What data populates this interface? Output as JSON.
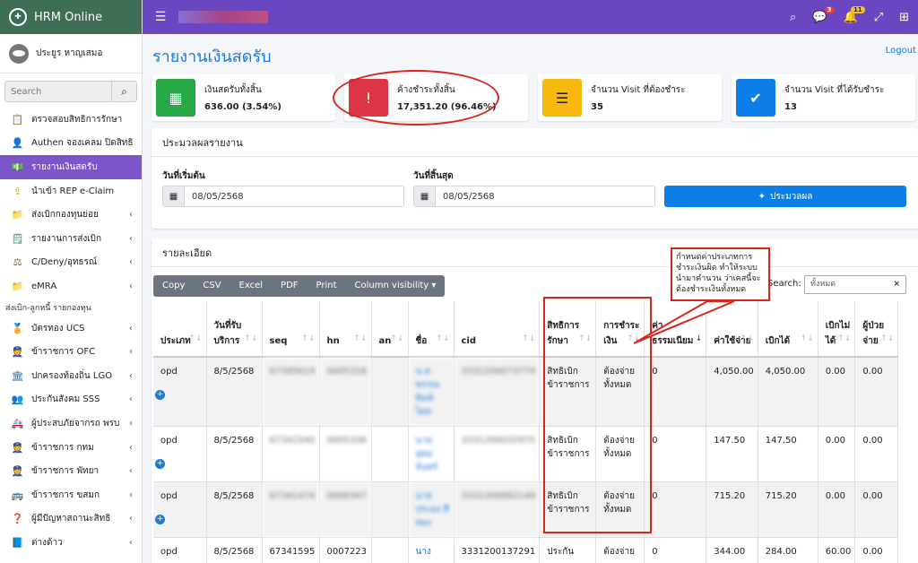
{
  "app": {
    "title": "HRM Online"
  },
  "user": {
    "name": "ประยูร หาญเสมอ"
  },
  "sidebar": {
    "search_placeholder": "Search",
    "items": [
      {
        "label": "ตรวจสอบสิทธิการรักษา",
        "icon": "clipboard-icon",
        "active": false,
        "chevron": false
      },
      {
        "label": "Authen จองเคลม ปิดสิทธิ",
        "icon": "doctor-icon",
        "active": false,
        "chevron": false
      },
      {
        "label": "รายงานเงินสดรับ",
        "icon": "money-icon",
        "active": true,
        "chevron": false
      },
      {
        "label": "นำเข้า REP e-Claim",
        "icon": "import-icon",
        "active": false,
        "chevron": false
      },
      {
        "label": "ส่งเบิกกองทุนย่อย",
        "icon": "folder-icon",
        "active": false,
        "chevron": true
      },
      {
        "label": "รายงานการส่งเบิก",
        "icon": "report-icon",
        "active": false,
        "chevron": true
      },
      {
        "label": "C/Deny/อุทธรณ์",
        "icon": "gavel-icon",
        "active": false,
        "chevron": true
      },
      {
        "label": "eMRA",
        "icon": "folder-icon",
        "active": false,
        "chevron": true
      }
    ],
    "section_header": "ส่งเบิก-ลูกหนี้ รายกองทุน",
    "items2": [
      {
        "label": "บัตรทอง UCS",
        "icon": "gold-card-icon"
      },
      {
        "label": "ข้าราชการ OFC",
        "icon": "officer-icon"
      },
      {
        "label": "ปกครองท้องถิ่น LGO",
        "icon": "building-icon"
      },
      {
        "label": "ประกันสังคม SSS",
        "icon": "people-icon"
      },
      {
        "label": "ผู้ประสบภัยจากรถ พรบ",
        "icon": "car-icon"
      },
      {
        "label": "ข้าราชการ กทม",
        "icon": "officer-icon"
      },
      {
        "label": "ข้าราชการ พัทยา",
        "icon": "officer-icon"
      },
      {
        "label": "ข้าราชการ ขสมก",
        "icon": "bus-icon"
      },
      {
        "label": "ผู้มีปัญหาสถานะสิทธิ",
        "icon": "question-icon"
      },
      {
        "label": "ต่างด้าว",
        "icon": "passport-icon"
      }
    ]
  },
  "topbar": {
    "badge_chat": "3",
    "badge_bell": "11"
  },
  "page": {
    "title": "รายงานเงินสดรับ",
    "logout": "Logout"
  },
  "cards": [
    {
      "label": "เงินสดรับทั้งสิ้น",
      "value": "636.00 (3.54%)",
      "color": "#28a745",
      "icon": "cash-register-icon"
    },
    {
      "label": "ค้างชำระทั้งสิ้น",
      "value": "17,351.20 (96.46%)",
      "color": "#dc3545",
      "icon": "alert-icon"
    },
    {
      "label": "จำนวน Visit ที่ต้องชำระ",
      "value": "35",
      "color": "#f7b90e",
      "icon": "list-check-icon"
    },
    {
      "label": "จำนวน Visit ที่ได้รับชำระ",
      "value": "13",
      "color": "#0d7ee8",
      "icon": "check-circle-icon"
    }
  ],
  "process": {
    "header": "ประมวลผลรายงาน",
    "start_label": "วันที่เริ่มต้น",
    "start_value": "08/05/2568",
    "end_label": "วันที่สิ้นสุด",
    "end_value": "08/05/2568",
    "button": "ประมวลผล"
  },
  "details": {
    "header": "รายละเอียด",
    "tools": [
      "Copy",
      "CSV",
      "Excel",
      "PDF",
      "Print",
      "Column visibility ▾"
    ],
    "search_label": "Search:",
    "search_value": "ทั้งหมด",
    "columns": [
      "ประเภท",
      "วันที่รับบริการ",
      "seq",
      "hn",
      "an",
      "ชื่อ",
      "cid",
      "สิทธิการรักษา",
      "การชำระเงิน",
      "ค่าธรรมเนียม",
      "ค่าใช้จ่าย",
      "เบิกได้",
      "เบิกไม่ได้",
      "ผู้ป่วยจ่าย"
    ],
    "rows": [
      {
        "type": "opd",
        "date": "8/5/2568",
        "seq": "67345614",
        "hn": "0005316",
        "an": "",
        "name": "น.ส. พรรณพิมพ์ ไผท",
        "cid": "3331200073774",
        "right": "สิทธิเบิกข้าราชการ",
        "pay": "ต้องจ่ายทั้งหมด",
        "fee": "0",
        "cost": "4,050.00",
        "claim": "4,050.00",
        "noclaim": "0.00",
        "patient": "0.00"
      },
      {
        "type": "opd",
        "date": "8/5/2568",
        "seq": "67341540",
        "hn": "0005336",
        "an": "",
        "name": "นาย อุดม จันทร์",
        "cid": "3331200032975",
        "right": "สิทธิเบิกข้าราชการ",
        "pay": "ต้องจ่ายทั้งหมด",
        "fee": "0",
        "cost": "147.50",
        "claim": "147.50",
        "noclaim": "0.00",
        "patient": "0.00"
      },
      {
        "type": "opd",
        "date": "8/5/2568",
        "seq": "67341474",
        "hn": "0006347",
        "an": "",
        "name": "นาย ประยง สีทอง",
        "cid": "3331200062149",
        "right": "สิทธิเบิกข้าราชการ",
        "pay": "ต้องจ่ายทั้งหมด",
        "fee": "0",
        "cost": "715.20",
        "claim": "715.20",
        "noclaim": "0.00",
        "patient": "0.00"
      },
      {
        "type": "opd",
        "date": "8/5/2568",
        "seq": "67341595",
        "hn": "0007223",
        "an": "",
        "name": "นาง",
        "cid": "3331200137291",
        "right": "ประกัน",
        "pay": "ต้องจ่าย",
        "fee": "0",
        "cost": "344.00",
        "claim": "284.00",
        "noclaim": "60.00",
        "patient": "0.00"
      }
    ]
  },
  "annotation": {
    "text": "กำหนดค่าประเภทการชำระเงินผิด ทำให้ระบบนำมาคำนวน ว่าเคสนี้จะต้องชำระเงินทั้งหมด"
  }
}
